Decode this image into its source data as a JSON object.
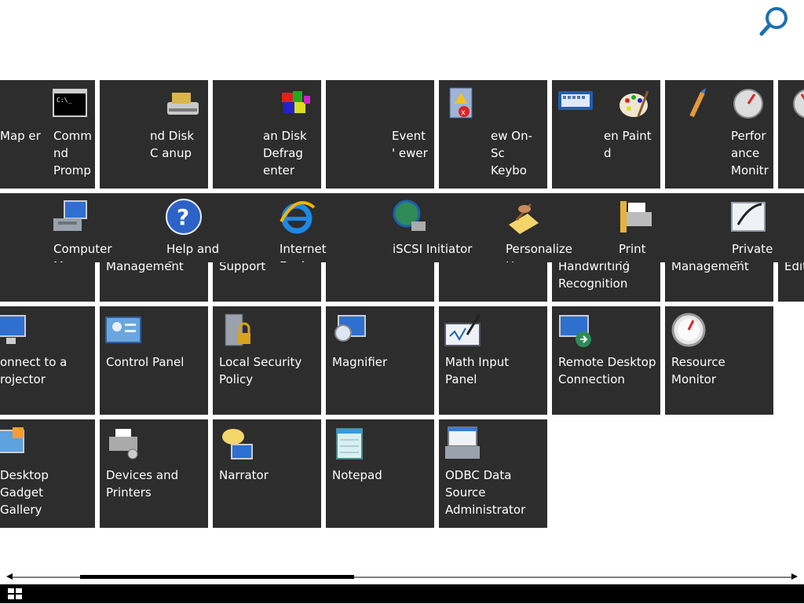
{
  "search": {
    "icon": "search-icon"
  },
  "row1": [
    {
      "name": "tile-remote-map",
      "label": "Map   er",
      "icon": "folder-icon"
    },
    {
      "name": "tile-command-prompt",
      "label": "Comm   nd\nPromp",
      "icon": "command-prompt-icon"
    },
    {
      "name": "tile-disk-cleanup",
      "label": "nd Disk C   anup",
      "icon": "disk-cleanup-icon"
    },
    {
      "name": "tile-disk-defragmenter",
      "label": "an Disk\nDefrag   enter",
      "icon": "defrag-icon"
    },
    {
      "name": "tile-event-viewer",
      "label": "Event ' ewer",
      "icon": "event-viewer-icon"
    },
    {
      "name": "tile-on-screen-keyboard",
      "label": "ew On-Sc\nKeybo",
      "icon": "keyboard-icon"
    },
    {
      "name": "tile-paint",
      "label": "en Paint\nd",
      "icon": "paint-icon"
    },
    {
      "name": "tile-performance-monitor",
      "label": "Perfor   ance\nMonitr",
      "icon": "performance-icon"
    },
    {
      "name": "tile-extra",
      "label": "",
      "icon": "gauge-icon"
    }
  ],
  "row2_back": [
    {
      "name": "tile-computer-management-back",
      "label": "Management"
    },
    {
      "name": "tile-help-support-back",
      "label": "Support"
    },
    {
      "name": "tile-handwriting-back",
      "label": "Handwriting\nRecognition"
    },
    {
      "name": "tile-print-management-back",
      "label": "Management"
    },
    {
      "name": "tile-edit-back",
      "label": "Edit"
    }
  ],
  "row2_front": [
    {
      "name": "tile-computer-management",
      "label": "Computer\nM",
      "icon": "computer-management-icon"
    },
    {
      "name": "tile-help-and-support",
      "label": "Help and\nS",
      "icon": "help-icon"
    },
    {
      "name": "tile-internet-explorer",
      "label": "Internet Explorer",
      "icon": "internet-explorer-icon"
    },
    {
      "name": "tile-iscsi-initiator",
      "label": "iSCSI Initiator",
      "icon": "iscsi-icon"
    },
    {
      "name": "tile-personalize",
      "label": "Personalize\nH",
      "icon": "personalize-icon"
    },
    {
      "name": "tile-print",
      "label": "Print\nM",
      "icon": "print-icon"
    },
    {
      "name": "tile-private-character-editor",
      "label": "Private Chara",
      "icon": "private-char-icon"
    }
  ],
  "row3": [
    {
      "name": "tile-connect-projector",
      "label": "onnect to a\nrojector",
      "icon": "projector-icon"
    },
    {
      "name": "tile-control-panel",
      "label": "Control Panel",
      "icon": "control-panel-icon"
    },
    {
      "name": "tile-local-security-policy",
      "label": "Local Security\nPolicy",
      "icon": "security-policy-icon"
    },
    {
      "name": "tile-magnifier",
      "label": "Magnifier",
      "icon": "magnifier-icon"
    },
    {
      "name": "tile-math-input-panel",
      "label": "Math Input Panel",
      "icon": "math-input-icon"
    },
    {
      "name": "tile-remote-desktop",
      "label": "Remote Desktop\nConnection",
      "icon": "remote-desktop-icon"
    },
    {
      "name": "tile-resource-monitor",
      "label": "Resource\nMonitor",
      "icon": "resource-monitor-icon"
    }
  ],
  "row4": [
    {
      "name": "tile-desktop-gadget-gallery",
      "label": "Desktop Gadget\nGallery",
      "icon": "gadget-icon"
    },
    {
      "name": "tile-devices-and-printers",
      "label": "Devices and\nPrinters",
      "icon": "devices-icon"
    },
    {
      "name": "tile-narrator",
      "label": "Narrator",
      "icon": "narrator-icon"
    },
    {
      "name": "tile-notepad",
      "label": "Notepad",
      "icon": "notepad-icon"
    },
    {
      "name": "tile-odbc",
      "label": "ODBC Data\nSource\nAdministrator",
      "icon": "odbc-icon"
    }
  ],
  "scrollbar": {
    "thumb_fraction_start": 0.1,
    "thumb_fraction_end": 0.44
  },
  "taskbar": {
    "start_icon": "windows-logo-icon"
  }
}
